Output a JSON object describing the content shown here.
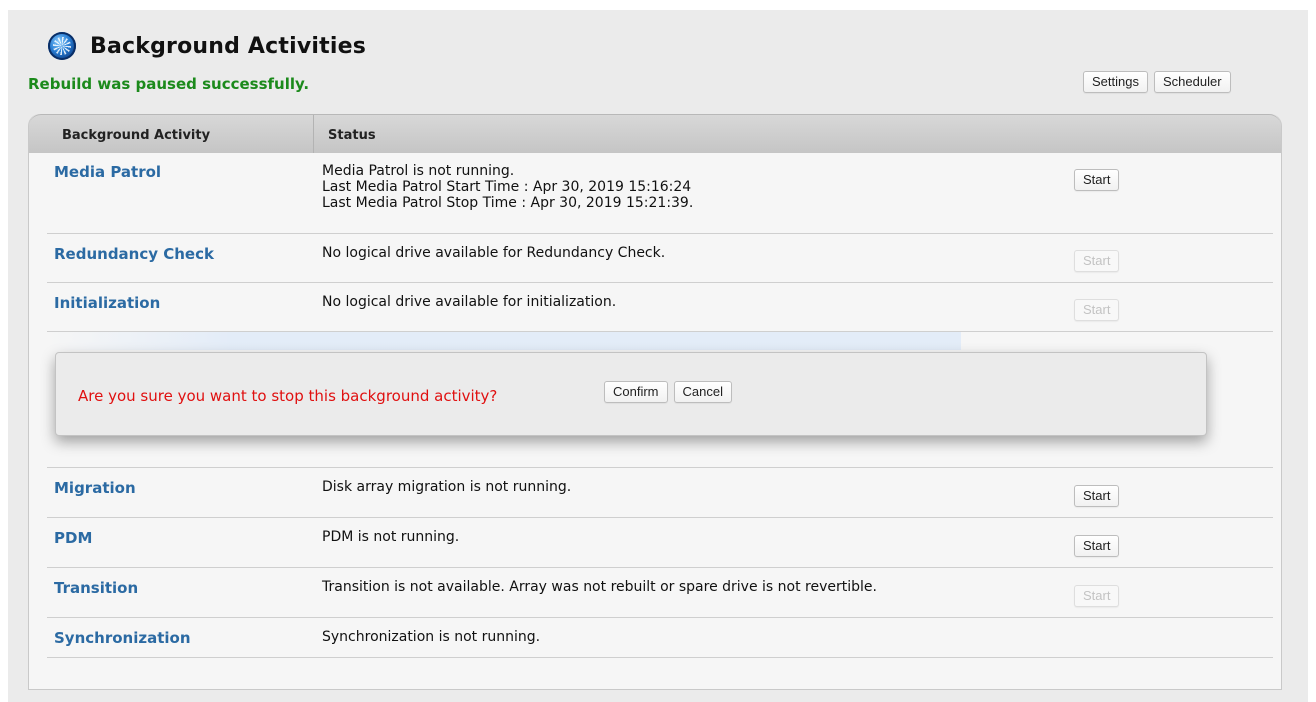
{
  "header": {
    "title": "Background Activities",
    "logo_icon": "globe-icon",
    "success_message": "Rebuild was paused successfully.",
    "settings_label": "Settings",
    "scheduler_label": "Scheduler"
  },
  "table": {
    "columns": [
      "Background Activity",
      "Status"
    ],
    "rows": [
      {
        "name": "Media Patrol",
        "status": [
          "Media Patrol is not running.",
          "Last Media Patrol Start Time : Apr 30, 2019 15:16:24",
          "Last Media Patrol Stop Time : Apr 30, 2019 15:21:39."
        ],
        "action": "Start",
        "enabled": true
      },
      {
        "name": "Redundancy Check",
        "status": [
          "No logical drive available for Redundancy Check."
        ],
        "action": "Start",
        "enabled": false
      },
      {
        "name": "Initialization",
        "status": [
          "No logical drive available for initialization."
        ],
        "action": "Start",
        "enabled": false
      },
      {
        "name": "Migration",
        "status": [
          "Disk array migration is not running."
        ],
        "action": "Start",
        "enabled": true
      },
      {
        "name": "PDM",
        "status": [
          "PDM is not running."
        ],
        "action": "Start",
        "enabled": true
      },
      {
        "name": "Transition",
        "status": [
          "Transition is not available. Array was not rebuilt or spare drive is not revertible."
        ],
        "action": "Start",
        "enabled": false
      },
      {
        "name": "Synchronization",
        "status": [
          "Synchronization is not running."
        ],
        "action": "",
        "enabled": false
      }
    ]
  },
  "dialog": {
    "message": "Are you sure you want to stop this background activity?",
    "confirm_label": "Confirm",
    "cancel_label": "Cancel"
  },
  "colors": {
    "success": "#1b8a1b",
    "link": "#2b6aa3",
    "warning": "#e01010"
  }
}
